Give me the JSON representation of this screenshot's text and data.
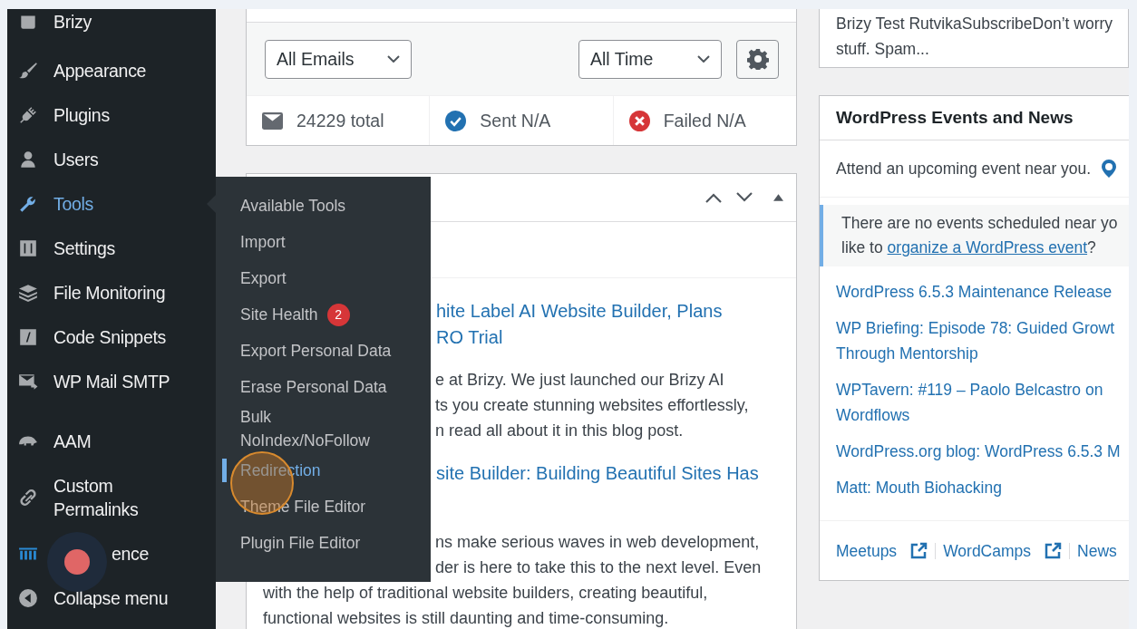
{
  "sidebar": {
    "items": [
      {
        "label": "Brizy",
        "selected": false
      },
      {
        "label": "Appearance",
        "selected": false
      },
      {
        "label": "Plugins",
        "selected": false
      },
      {
        "label": "Users",
        "selected": false
      },
      {
        "label": "Tools",
        "selected": true
      },
      {
        "label": "Settings",
        "selected": false
      },
      {
        "label": "File Monitoring",
        "selected": false
      },
      {
        "label": "Code Snippets",
        "selected": false
      },
      {
        "label": "WP Mail SMTP",
        "selected": false
      },
      {
        "label": "AAM",
        "selected": false
      },
      {
        "label": "Custom Permalinks",
        "selected": false
      },
      {
        "label": "ence",
        "selected": false
      },
      {
        "label": "Collapse menu",
        "selected": false
      }
    ]
  },
  "tools_submenu": {
    "items": [
      {
        "label": "Available Tools",
        "selected": false
      },
      {
        "label": "Import",
        "selected": false
      },
      {
        "label": "Export",
        "selected": false
      },
      {
        "label": "Site Health",
        "selected": false,
        "badge": "2"
      },
      {
        "label": "Export Personal Data",
        "selected": false
      },
      {
        "label": "Erase Personal Data",
        "selected": false
      },
      {
        "label": "Bulk NoIndex/NoFollow",
        "selected": false
      },
      {
        "label": "Redirection",
        "selected": true
      },
      {
        "label": "Theme File Editor",
        "selected": false
      },
      {
        "label": "Plugin File Editor",
        "selected": false
      }
    ]
  },
  "email_widget": {
    "filters": [
      {
        "label": "All Emails"
      },
      {
        "label": "All Time"
      }
    ],
    "stats": [
      {
        "kind": "total",
        "label": "24229 total"
      },
      {
        "kind": "sent",
        "label": "Sent N/A"
      },
      {
        "kind": "failed",
        "label": "Failed N/A"
      }
    ]
  },
  "news_widget": {
    "posts": [
      {
        "title_lines": [
          "hite Label AI Website Builder, Plans",
          "RO Trial"
        ],
        "text_lines": [
          {
            "text": "e at Brizy. We just launched our Brizy AI",
            "clipped": true
          },
          {
            "text": "ts you create stunning websites effortlessly,",
            "clipped": true
          },
          {
            "text": "n read all about it in this blog post.",
            "clipped": true
          }
        ]
      },
      {
        "title_lines": [
          "site Builder: Building Beautiful Sites Has"
        ],
        "text_lines": [
          {
            "text": "ns make serious waves in web development,",
            "clipped": true
          },
          {
            "text": "der is here to take this to the next level. Even",
            "clipped": true
          },
          {
            "text": "with the help of traditional website builders, creating beautiful,",
            "clipped": false
          },
          {
            "text": "functional websites is still daunting and time-consuming.",
            "clipped": false
          }
        ]
      }
    ]
  },
  "activity_widget": {
    "lines": [
      "Brizy Test RutvikaSubscribeDon’t worry",
      "stuff. Spam..."
    ]
  },
  "events_news": {
    "title": "WordPress Events and News",
    "attend": "Attend an upcoming event near you.",
    "notice": {
      "line_1": "There are no events scheduled near yo",
      "before": "like to ",
      "link": "organize a WordPress event",
      "after": "?"
    },
    "news": [
      {
        "lines": [
          "WordPress 6.5.3 Maintenance Release"
        ]
      },
      {
        "lines": [
          "WP Briefing: Episode 78: Guided Growt",
          "Through Mentorship"
        ]
      },
      {
        "lines": [
          "WPTavern: #119 – Paolo Belcastro on",
          "Wordflows"
        ]
      },
      {
        "lines": [
          "WordPress.org blog: WordPress 6.5.3 M"
        ]
      },
      {
        "lines": [
          "Matt: Mouth Biohacking"
        ]
      }
    ],
    "footer": [
      {
        "label": "Meetups",
        "external": true
      },
      {
        "label": "WordCamps",
        "external": true
      },
      {
        "label": "News",
        "external": false
      }
    ]
  }
}
